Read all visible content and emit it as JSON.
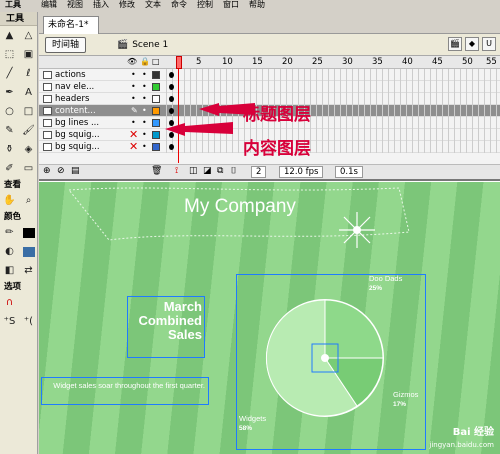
{
  "menubar": {
    "items": [
      "工具",
      "编辑",
      "视图",
      "插入",
      "修改",
      "文本",
      "命令",
      "控制",
      "窗口",
      "帮助"
    ]
  },
  "tools": {
    "title": "工具",
    "sections": [
      "查看",
      "颜色",
      "选项"
    ]
  },
  "document": {
    "tab_title": "未命名-1*",
    "timeline_button": "时间轴",
    "scene": "Scene 1",
    "zoom": "U"
  },
  "timeline": {
    "ruler": [
      "1",
      "5",
      "10",
      "15",
      "20",
      "25",
      "30",
      "35",
      "40",
      "45",
      "50",
      "55"
    ],
    "layers": [
      {
        "name": "actions",
        "color": "#333333"
      },
      {
        "name": "nav ele...",
        "color": "#33cc33"
      },
      {
        "name": "headers",
        "color": "#ffffff"
      },
      {
        "name": "content...",
        "color": "#ff9900",
        "selected": true
      },
      {
        "name": "bg lines ...",
        "color": "#3399ff"
      },
      {
        "name": "bg squig...",
        "color": "#0099cc",
        "hidden": true
      },
      {
        "name": "bg squig...",
        "color": "#3366cc",
        "hidden": true
      }
    ],
    "frame": "2",
    "fps": "12.0 fps",
    "time": "0.1s"
  },
  "annotations": {
    "title_layer": "标题图层",
    "content_layer": "内容图层"
  },
  "stage": {
    "company": "My Company",
    "heading_line1": "March",
    "heading_line2": "Combined",
    "heading_line3": "Sales",
    "subtitle": "Widget sales soar throughout the first quarter.",
    "pie": {
      "slices": [
        {
          "label": "Doo Dads",
          "pct": "25%"
        },
        {
          "label": "Gizmos",
          "pct": "17%"
        },
        {
          "label": "Widgets",
          "pct": "58%"
        }
      ]
    },
    "watermark_brand": "Bai 经验",
    "watermark_url": "jingyan.baidu.com"
  },
  "colors": {
    "accent_annotation": "#d8003a",
    "stage_green": "#8fd28a",
    "selection": "#1f7bff"
  }
}
